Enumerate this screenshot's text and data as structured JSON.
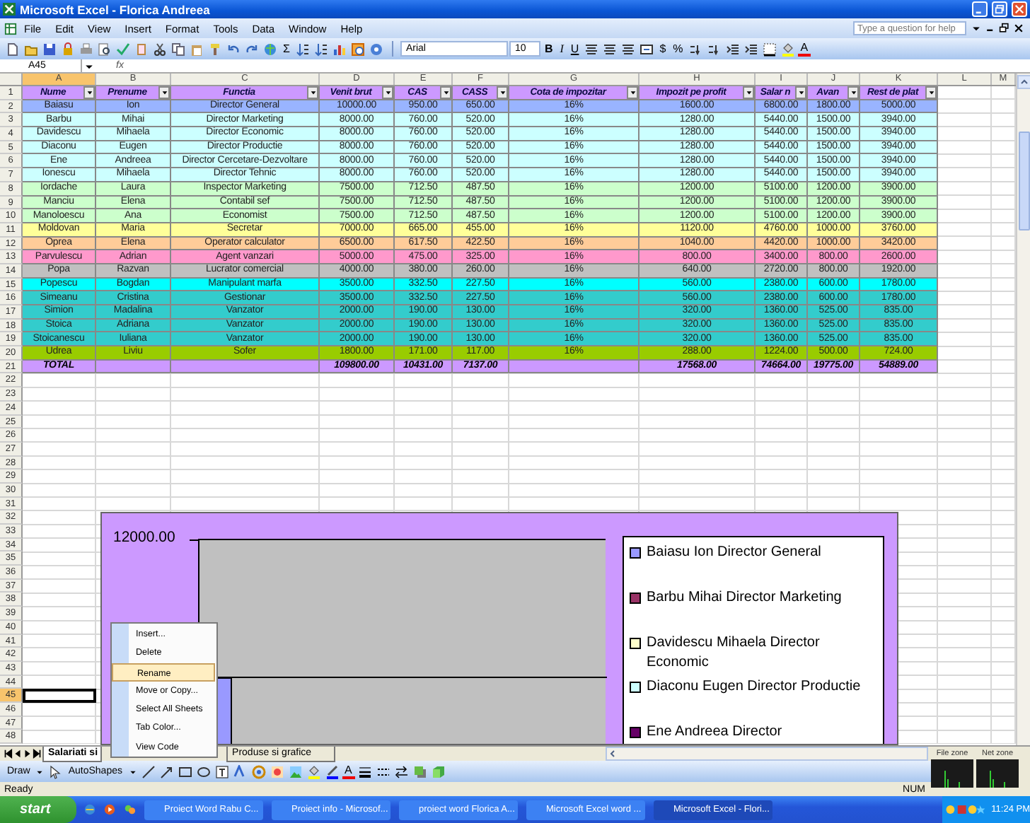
{
  "window": {
    "title": "Microsoft Excel - Florica Andreea"
  },
  "menu": [
    {
      "label": "File"
    },
    {
      "label": "Edit"
    },
    {
      "label": "View"
    },
    {
      "label": "Insert"
    },
    {
      "label": "Format"
    },
    {
      "label": "Tools"
    },
    {
      "label": "Data"
    },
    {
      "label": "Window"
    },
    {
      "label": "Help"
    }
  ],
  "help_search": {
    "placeholder": "Type a question for help"
  },
  "toolbar": {
    "autosum": "Σ",
    "font": "Arial",
    "font_size": "10",
    "bold": "B",
    "italic": "I",
    "underline": "U",
    "currency": "$",
    "percent": "%",
    "font_color": "A"
  },
  "formula_bar": {
    "name_box": "A45",
    "function_label": "fx"
  },
  "columns": [
    {
      "label": "A",
      "selected": true
    },
    {
      "label": "B",
      "selected": false
    },
    {
      "label": "C",
      "selected": false
    },
    {
      "label": "D",
      "selected": false
    },
    {
      "label": "E",
      "selected": false
    },
    {
      "label": "F",
      "selected": false
    },
    {
      "label": "G",
      "selected": false
    },
    {
      "label": "H",
      "selected": false
    },
    {
      "label": "I",
      "selected": false
    },
    {
      "label": "J",
      "selected": false
    },
    {
      "label": "K",
      "selected": false
    },
    {
      "label": "L",
      "selected": false
    },
    {
      "label": "M",
      "selected": false
    }
  ],
  "rows": [
    {
      "number": "1",
      "kind": "header",
      "color": "#cc99ff",
      "cells": [
        "Nume",
        "Prenume",
        "Functia",
        "Venit brut",
        "CAS",
        "CASS",
        "Cota de impozitar",
        "Impozit pe profit",
        "Salar n",
        "Avan",
        "Rest de plat"
      ]
    },
    {
      "number": "2",
      "kind": "data",
      "color": "#99b4ff",
      "cells": [
        "Baiasu",
        "Ion",
        "Director General",
        "10000.00",
        "950.00",
        "650.00",
        "16%",
        "1600.00",
        "6800.00",
        "1800.00",
        "5000.00"
      ]
    },
    {
      "number": "3",
      "kind": "data",
      "color": "#ccffff",
      "cells": [
        "Barbu",
        "Mihai",
        "Director Marketing",
        "8000.00",
        "760.00",
        "520.00",
        "16%",
        "1280.00",
        "5440.00",
        "1500.00",
        "3940.00"
      ]
    },
    {
      "number": "4",
      "kind": "data",
      "color": "#ccffff",
      "cells": [
        "Davidescu",
        "Mihaela",
        "Director Economic",
        "8000.00",
        "760.00",
        "520.00",
        "16%",
        "1280.00",
        "5440.00",
        "1500.00",
        "3940.00"
      ]
    },
    {
      "number": "5",
      "kind": "data",
      "color": "#ccffff",
      "cells": [
        "Diaconu",
        "Eugen",
        "Director  Productie",
        "8000.00",
        "760.00",
        "520.00",
        "16%",
        "1280.00",
        "5440.00",
        "1500.00",
        "3940.00"
      ]
    },
    {
      "number": "6",
      "kind": "data",
      "color": "#ccffff",
      "cells": [
        "Ene",
        "Andreea",
        "Director Cercetare-Dezvoltare",
        "8000.00",
        "760.00",
        "520.00",
        "16%",
        "1280.00",
        "5440.00",
        "1500.00",
        "3940.00"
      ]
    },
    {
      "number": "7",
      "kind": "data",
      "color": "#ccffff",
      "cells": [
        "Ionescu",
        "Mihaela",
        "Director Tehnic",
        "8000.00",
        "760.00",
        "520.00",
        "16%",
        "1280.00",
        "5440.00",
        "1500.00",
        "3940.00"
      ]
    },
    {
      "number": "8",
      "kind": "data",
      "color": "#ccffcc",
      "cells": [
        "Iordache",
        "Laura",
        "Inspector Marketing",
        "7500.00",
        "712.50",
        "487.50",
        "16%",
        "1200.00",
        "5100.00",
        "1200.00",
        "3900.00"
      ]
    },
    {
      "number": "9",
      "kind": "data",
      "color": "#ccffcc",
      "cells": [
        "Manciu",
        "Elena",
        "Contabil sef",
        "7500.00",
        "712.50",
        "487.50",
        "16%",
        "1200.00",
        "5100.00",
        "1200.00",
        "3900.00"
      ]
    },
    {
      "number": "10",
      "kind": "data",
      "color": "#ccffcc",
      "cells": [
        "Manoloescu",
        "Ana",
        "Economist",
        "7500.00",
        "712.50",
        "487.50",
        "16%",
        "1200.00",
        "5100.00",
        "1200.00",
        "3900.00"
      ]
    },
    {
      "number": "11",
      "kind": "data",
      "color": "#ffff99",
      "cells": [
        "Moldovan",
        "Maria",
        "Secretar",
        "7000.00",
        "665.00",
        "455.00",
        "16%",
        "1120.00",
        "4760.00",
        "1000.00",
        "3760.00"
      ]
    },
    {
      "number": "12",
      "kind": "data",
      "color": "#ffcc99",
      "cells": [
        "Oprea",
        "Elena",
        "Operator calculator",
        "6500.00",
        "617.50",
        "422.50",
        "16%",
        "1040.00",
        "4420.00",
        "1000.00",
        "3420.00"
      ]
    },
    {
      "number": "13",
      "kind": "data",
      "color": "#ff99cc",
      "cells": [
        "Parvulescu",
        "Adrian",
        "Agent vanzari",
        "5000.00",
        "475.00",
        "325.00",
        "16%",
        "800.00",
        "3400.00",
        "800.00",
        "2600.00"
      ]
    },
    {
      "number": "14",
      "kind": "data",
      "color": "#c0c0c0",
      "cells": [
        "Popa",
        "Razvan",
        "Lucrator comercial",
        "4000.00",
        "380.00",
        "260.00",
        "16%",
        "640.00",
        "2720.00",
        "800.00",
        "1920.00"
      ]
    },
    {
      "number": "15",
      "kind": "data",
      "color": "#00ffff",
      "cells": [
        "Popescu",
        "Bogdan",
        "Manipulant marfa",
        "3500.00",
        "332.50",
        "227.50",
        "16%",
        "560.00",
        "2380.00",
        "600.00",
        "1780.00"
      ]
    },
    {
      "number": "16",
      "kind": "data",
      "color": "#33cccc",
      "cells": [
        "Simeanu",
        "Cristina",
        "Gestionar",
        "3500.00",
        "332.50",
        "227.50",
        "16%",
        "560.00",
        "2380.00",
        "600.00",
        "1780.00"
      ]
    },
    {
      "number": "17",
      "kind": "data",
      "color": "#33cccc",
      "cells": [
        "Simion",
        "Madalina",
        "Vanzator",
        "2000.00",
        "190.00",
        "130.00",
        "16%",
        "320.00",
        "1360.00",
        "525.00",
        "835.00"
      ]
    },
    {
      "number": "18",
      "kind": "data",
      "color": "#33cccc",
      "cells": [
        "Stoica",
        "Adriana",
        "Vanzator",
        "2000.00",
        "190.00",
        "130.00",
        "16%",
        "320.00",
        "1360.00",
        "525.00",
        "835.00"
      ]
    },
    {
      "number": "19",
      "kind": "data",
      "color": "#33cccc",
      "cells": [
        "Stoicanescu",
        "Iuliana",
        "Vanzator",
        "2000.00",
        "190.00",
        "130.00",
        "16%",
        "320.00",
        "1360.00",
        "525.00",
        "835.00"
      ]
    },
    {
      "number": "20",
      "kind": "data",
      "color": "#99cc00",
      "cells": [
        "Udrea",
        "Liviu",
        "Sofer",
        "1800.00",
        "171.00",
        "117.00",
        "16%",
        "288.00",
        "1224.00",
        "500.00",
        "724.00"
      ]
    },
    {
      "number": "21",
      "kind": "total",
      "color": "#cc99ff",
      "cells": [
        "TOTAL",
        null,
        null,
        "109800.00",
        "10431.00",
        "7137.00",
        null,
        "17568.00",
        "74664.00",
        "19775.00",
        "54889.00"
      ]
    }
  ],
  "empty_rows": [
    {
      "number": "22",
      "selected": false
    },
    {
      "number": "23",
      "selected": false
    },
    {
      "number": "24",
      "selected": false
    },
    {
      "number": "25",
      "selected": false
    },
    {
      "number": "26",
      "selected": false
    },
    {
      "number": "27",
      "selected": false
    },
    {
      "number": "28",
      "selected": false
    },
    {
      "number": "29",
      "selected": false
    },
    {
      "number": "30",
      "selected": false
    },
    {
      "number": "31",
      "selected": false
    },
    {
      "number": "32",
      "selected": false
    },
    {
      "number": "33",
      "selected": false
    },
    {
      "number": "34",
      "selected": false
    },
    {
      "number": "35",
      "selected": false
    },
    {
      "number": "36",
      "selected": false
    },
    {
      "number": "37",
      "selected": false
    },
    {
      "number": "38",
      "selected": false
    },
    {
      "number": "39",
      "selected": false
    },
    {
      "number": "40",
      "selected": false
    },
    {
      "number": "41",
      "selected": false
    },
    {
      "number": "42",
      "selected": false
    },
    {
      "number": "43",
      "selected": false
    },
    {
      "number": "44",
      "selected": false
    },
    {
      "number": "45",
      "selected": true
    },
    {
      "number": "46",
      "selected": false
    },
    {
      "number": "47",
      "selected": false
    },
    {
      "number": "48",
      "selected": false
    }
  ],
  "chart": {
    "axis_label": "12000.00",
    "legend": [
      {
        "label": "Baiasu Ion Director General",
        "color": "#9999ff"
      },
      {
        "label": "Barbu Mihai Director Marketing",
        "color": "#993366"
      },
      {
        "label": "Davidescu Mihaela Director Economic",
        "color": "#ffffcc"
      },
      {
        "label": "Diaconu Eugen Director Productie",
        "color": "#ccffff"
      },
      {
        "label": "Ene Andreea Director",
        "color": "#660066"
      }
    ]
  },
  "context_menu": [
    {
      "label": "Insert...",
      "selected": false
    },
    {
      "label": "Delete",
      "selected": false
    },
    {
      "label": "Rename",
      "selected": true
    },
    {
      "label": "Move or Copy...",
      "selected": false
    },
    {
      "label": "Select All Sheets",
      "selected": false
    },
    {
      "label": "Tab Color...",
      "selected": false
    },
    {
      "label": "View Code",
      "selected": false
    }
  ],
  "sheet_tabs": [
    {
      "label": "Salariati si",
      "selected": true
    },
    {
      "label": "Produse si grafice",
      "selected": false
    }
  ],
  "drawing_toolbar": {
    "draw": "Draw",
    "autoshapes": "AutoShapes",
    "font_color": "A"
  },
  "monitor": [
    {
      "label": "File zone"
    },
    {
      "label": "Net zone"
    }
  ],
  "status_bar": {
    "status": "Ready",
    "num_lock": "NUM"
  },
  "taskbar": {
    "start": "start",
    "buttons": [
      {
        "label": "Proiect Word Rabu C...",
        "selected": false
      },
      {
        "label": "Proiect info - Microsof...",
        "selected": false
      },
      {
        "label": "proiect word Florica A...",
        "selected": false
      },
      {
        "label": "Microsoft Excel word ...",
        "selected": false
      },
      {
        "label": "Microsoft Excel - Flori...",
        "selected": true
      }
    ],
    "clock": "11:24 PM"
  }
}
